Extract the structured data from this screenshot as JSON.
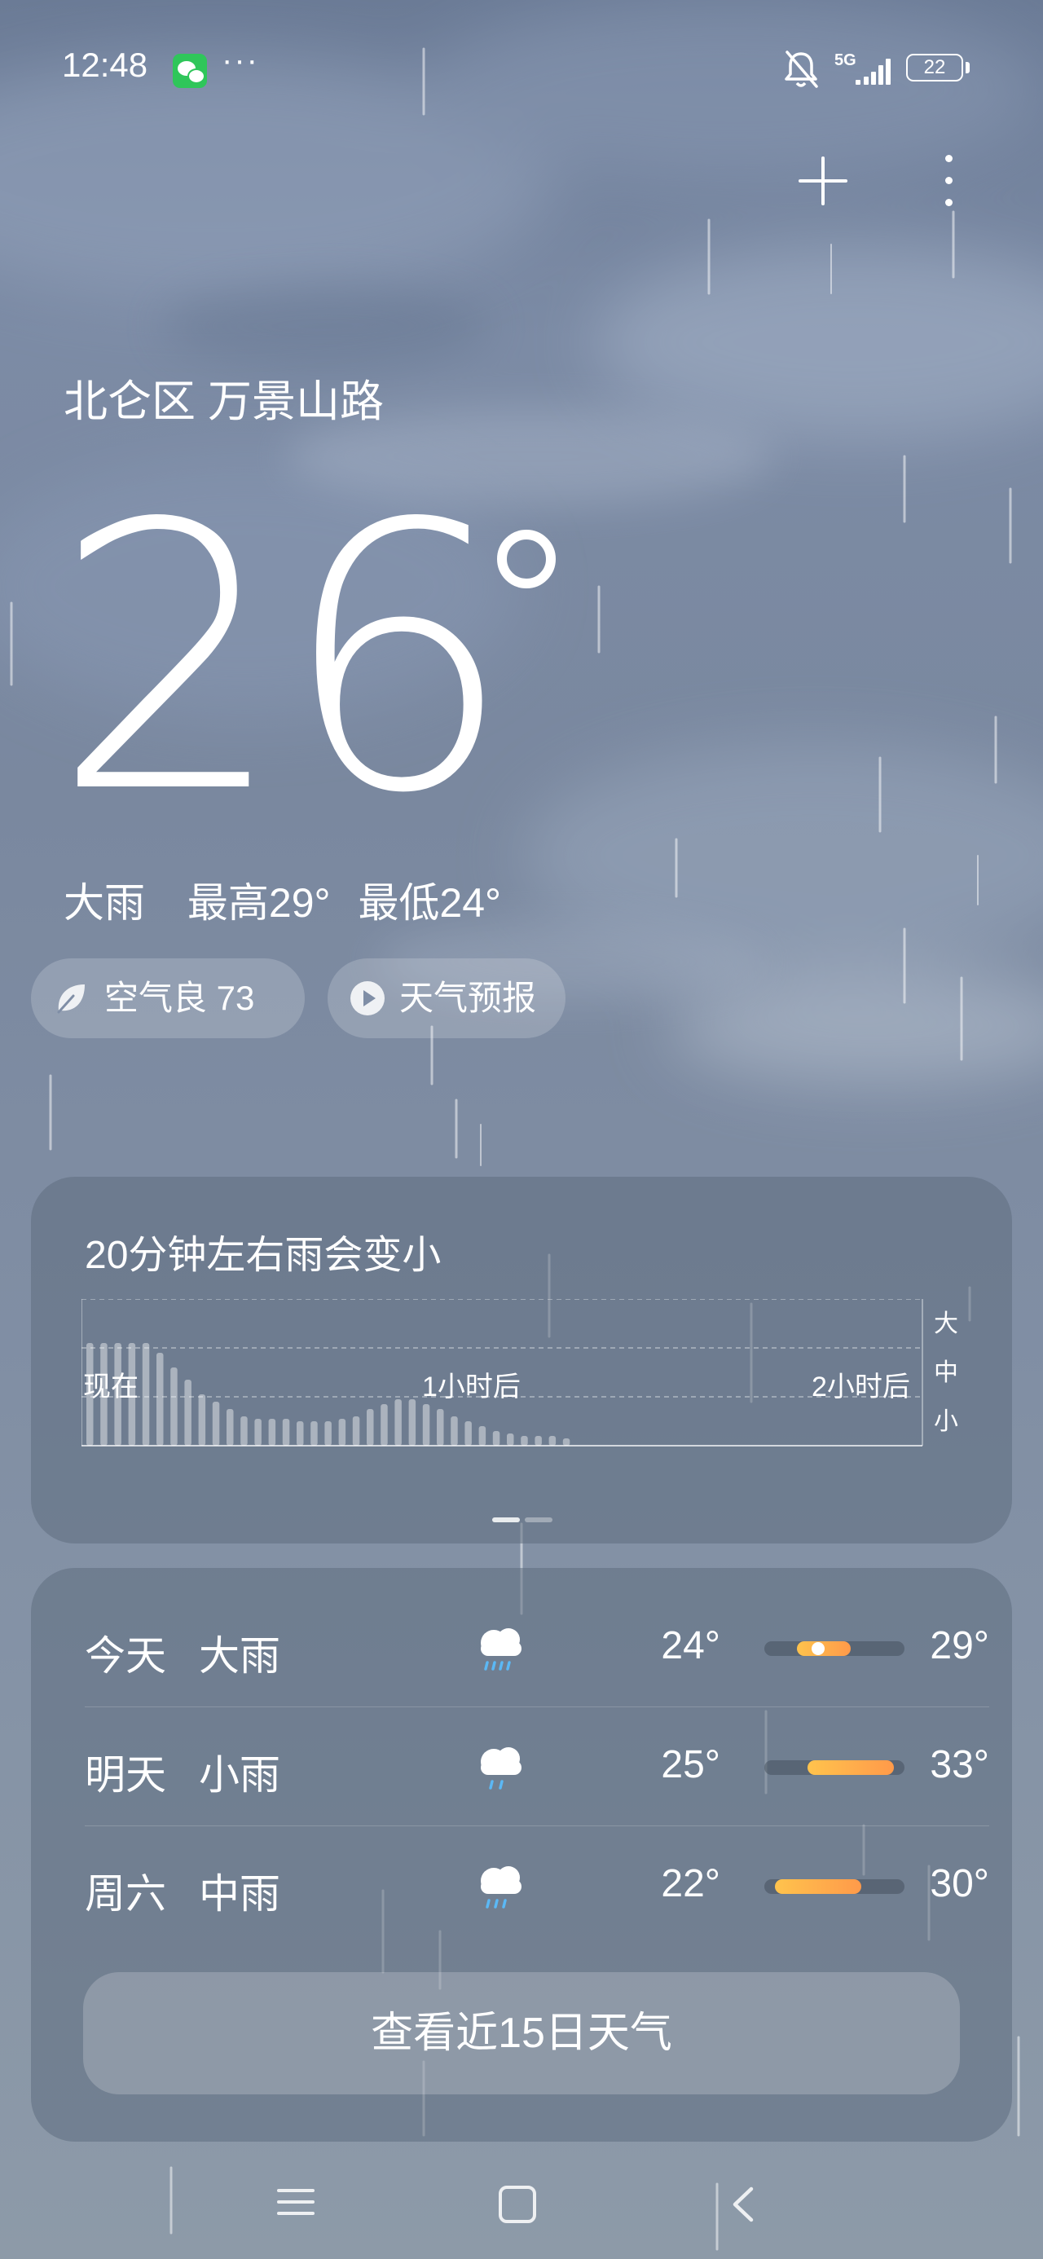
{
  "status_bar": {
    "time": "12:48",
    "more_indicator": "···",
    "network": "5G",
    "battery": "22",
    "icons": [
      "wechat-icon",
      "bell-muted-icon",
      "signal-icon",
      "battery-icon"
    ]
  },
  "header_actions": {
    "icons": [
      "plus-icon",
      "more-vertical-icon"
    ]
  },
  "location": "北仑区 万景山路",
  "current": {
    "temperature": "26",
    "condition": "大雨",
    "high": "最高29°",
    "low": "最低24°"
  },
  "chips": {
    "aqi": {
      "label": "空气良 73",
      "icon": "leaf-icon"
    },
    "video": {
      "label": "天气预报",
      "icon": "play-icon"
    }
  },
  "precipitation": {
    "title": "20分钟左右雨会变小",
    "y_labels": [
      "大",
      "中",
      "小"
    ],
    "x_labels": [
      "现在",
      "1小时后",
      "2小时后"
    ],
    "pager_pages": 2,
    "pager_active": 0,
    "chart_data": {
      "type": "bar",
      "x": "time since now (minutes, ~2.5 min per bar)",
      "y_levels": [
        "小",
        "中",
        "大"
      ],
      "values": [
        2.1,
        2.1,
        2.1,
        2.1,
        2.1,
        1.9,
        1.6,
        1.35,
        1.05,
        0.9,
        0.75,
        0.6,
        0.55,
        0.55,
        0.55,
        0.5,
        0.5,
        0.5,
        0.55,
        0.6,
        0.75,
        0.85,
        0.95,
        0.95,
        0.85,
        0.75,
        0.6,
        0.5,
        0.4,
        0.3,
        0.25,
        0.2,
        0.2,
        0.2,
        0.15,
        0,
        0,
        0,
        0,
        0,
        0,
        0,
        0,
        0,
        0,
        0,
        0,
        0
      ],
      "ylim": [
        0,
        3
      ]
    }
  },
  "forecast": {
    "days": [
      {
        "day": "今天",
        "condition": "大雨",
        "low": "24°",
        "high": "29°",
        "low_val": 24,
        "high_val": 29,
        "show_now": true,
        "icon": "heavy-rain-icon"
      },
      {
        "day": "明天",
        "condition": "小雨",
        "low": "25°",
        "high": "33°",
        "low_val": 25,
        "high_val": 33,
        "show_now": false,
        "icon": "light-rain-icon"
      },
      {
        "day": "周六",
        "condition": "中雨",
        "low": "22°",
        "high": "30°",
        "low_val": 22,
        "high_val": 30,
        "show_now": false,
        "icon": "moderate-rain-icon"
      }
    ],
    "range": [
      21,
      34
    ],
    "current_temp": 26,
    "more_button": "查看近15日天气"
  },
  "nav": {
    "icons": [
      "menu-icon",
      "home-icon",
      "back-icon"
    ]
  }
}
